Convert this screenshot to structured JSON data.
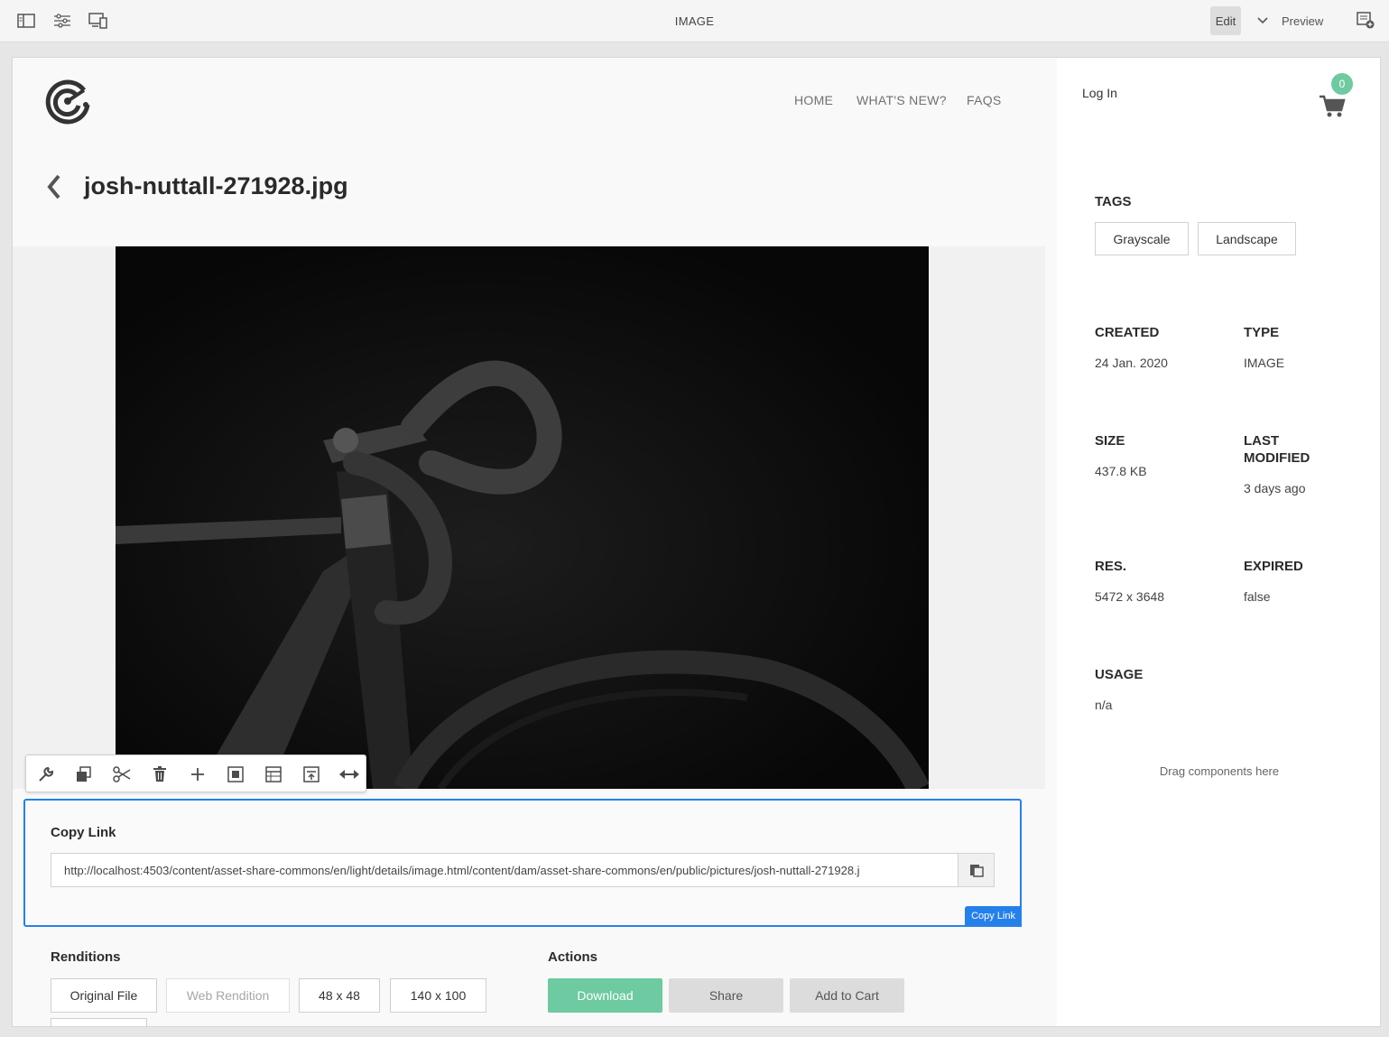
{
  "topbar": {
    "title": "IMAGE",
    "edit_label": "Edit",
    "preview_label": "Preview",
    "icons": [
      "side-panel-icon",
      "properties-icon",
      "emulator-icon",
      "chevron-down-icon",
      "annotate-icon"
    ]
  },
  "site": {
    "nav": [
      "HOME",
      "WHAT'S NEW?",
      "FAQS"
    ],
    "login_label": "Log In",
    "cart_count": "0"
  },
  "asset": {
    "title": "josh-nuttall-271928.jpg"
  },
  "component_toolbar": {
    "icons": [
      "wrench-icon",
      "copy-icon",
      "scissors-icon",
      "trash-icon",
      "plus-icon",
      "group-icon",
      "layout-icon",
      "parent-icon",
      "resize-icon"
    ]
  },
  "copy_link": {
    "title": "Copy Link",
    "url": "http://localhost:4503/content/asset-share-commons/en/light/details/image.html/content/dam/asset-share-commons/en/public/pictures/josh-nuttall-271928.j",
    "badge": "Copy Link"
  },
  "renditions": {
    "title": "Renditions",
    "items": [
      "Original File",
      "Web Rendition",
      "48 x 48",
      "140 x 100"
    ]
  },
  "actions": {
    "title": "Actions",
    "download": "Download",
    "share": "Share",
    "add_to_cart": "Add to Cart"
  },
  "metadata": {
    "tags_label": "TAGS",
    "tags": [
      "Grayscale",
      "Landscape"
    ],
    "created_label": "CREATED",
    "created_value": "24 Jan. 2020",
    "type_label": "TYPE",
    "type_value": "IMAGE",
    "size_label": "SIZE",
    "size_value": "437.8 KB",
    "last_modified_label_1": "LAST",
    "last_modified_label_2": "MODIFIED",
    "last_modified_value": "3 days ago",
    "res_label": "RES.",
    "res_value": "5472 x 3648",
    "expired_label": "EXPIRED",
    "expired_value": "false",
    "usage_label": "USAGE",
    "usage_value": "n/a",
    "drag_label": "Drag components here"
  },
  "colors": {
    "accent": "#2680eb",
    "primary_button": "#6dcaa1",
    "secondary_button": "#dcdcdc"
  }
}
